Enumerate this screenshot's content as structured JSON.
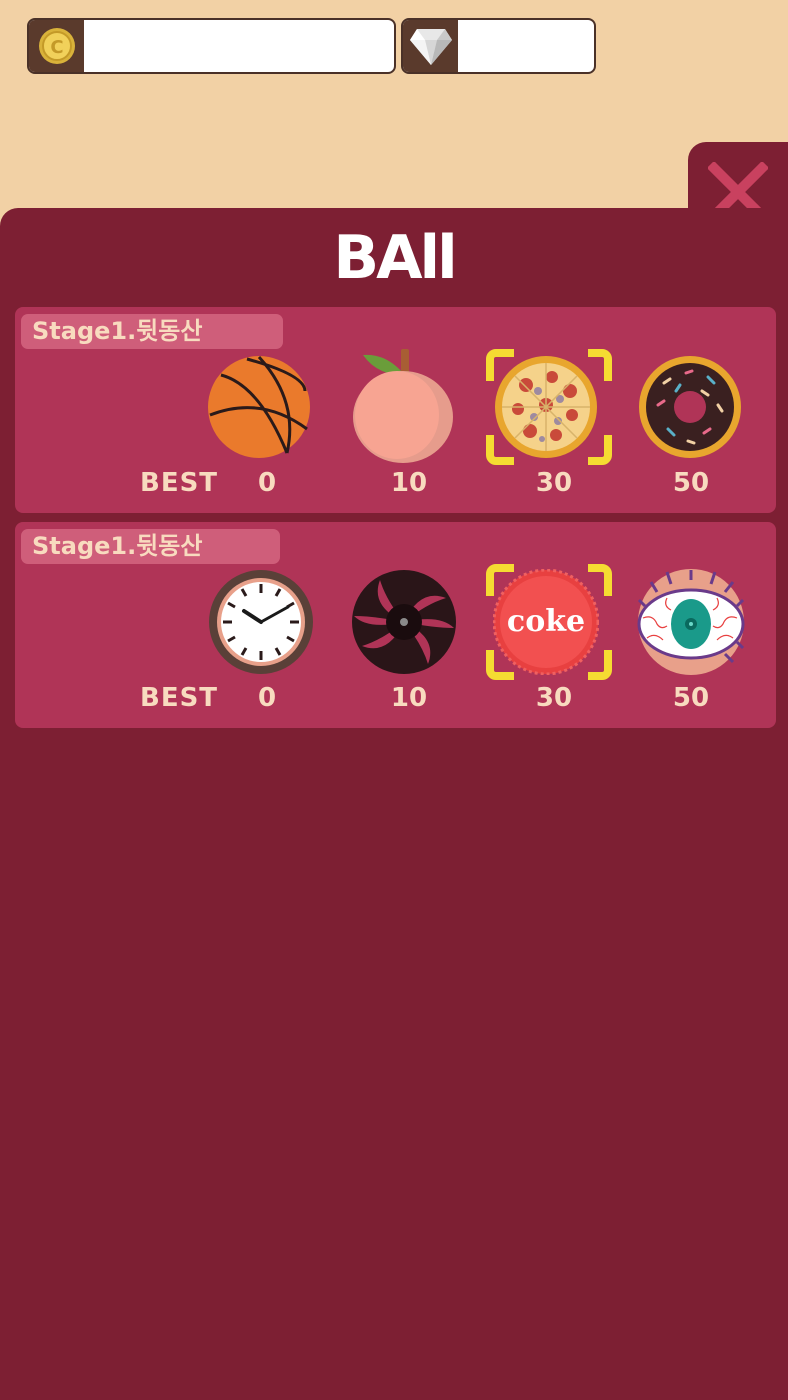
{
  "currency": {
    "coins": "",
    "gems": ""
  },
  "panel": {
    "title": "BAll"
  },
  "stages": [
    {
      "name": "Stage1.뒷동산",
      "best_label": "BEST",
      "selected_index": 2,
      "balls": [
        {
          "icon": "basketball-icon",
          "score": "0"
        },
        {
          "icon": "peach-icon",
          "score": "10"
        },
        {
          "icon": "pizza-icon",
          "score": "30"
        },
        {
          "icon": "donut-icon",
          "score": "50"
        }
      ]
    },
    {
      "name": "Stage1.뒷동산",
      "best_label": "BEST",
      "selected_index": 2,
      "balls": [
        {
          "icon": "clock-icon",
          "score": "0"
        },
        {
          "icon": "black-hole-icon",
          "score": "10"
        },
        {
          "icon": "coke-cap-icon",
          "score": "30",
          "text": "coke"
        },
        {
          "icon": "eyeball-icon",
          "score": "50"
        }
      ]
    }
  ],
  "colors": {
    "background": "#f2d1a5",
    "panel": "#7d1f33",
    "card": "#b03457",
    "label_text": "#f8dbbf",
    "selector": "#f5dc32"
  }
}
